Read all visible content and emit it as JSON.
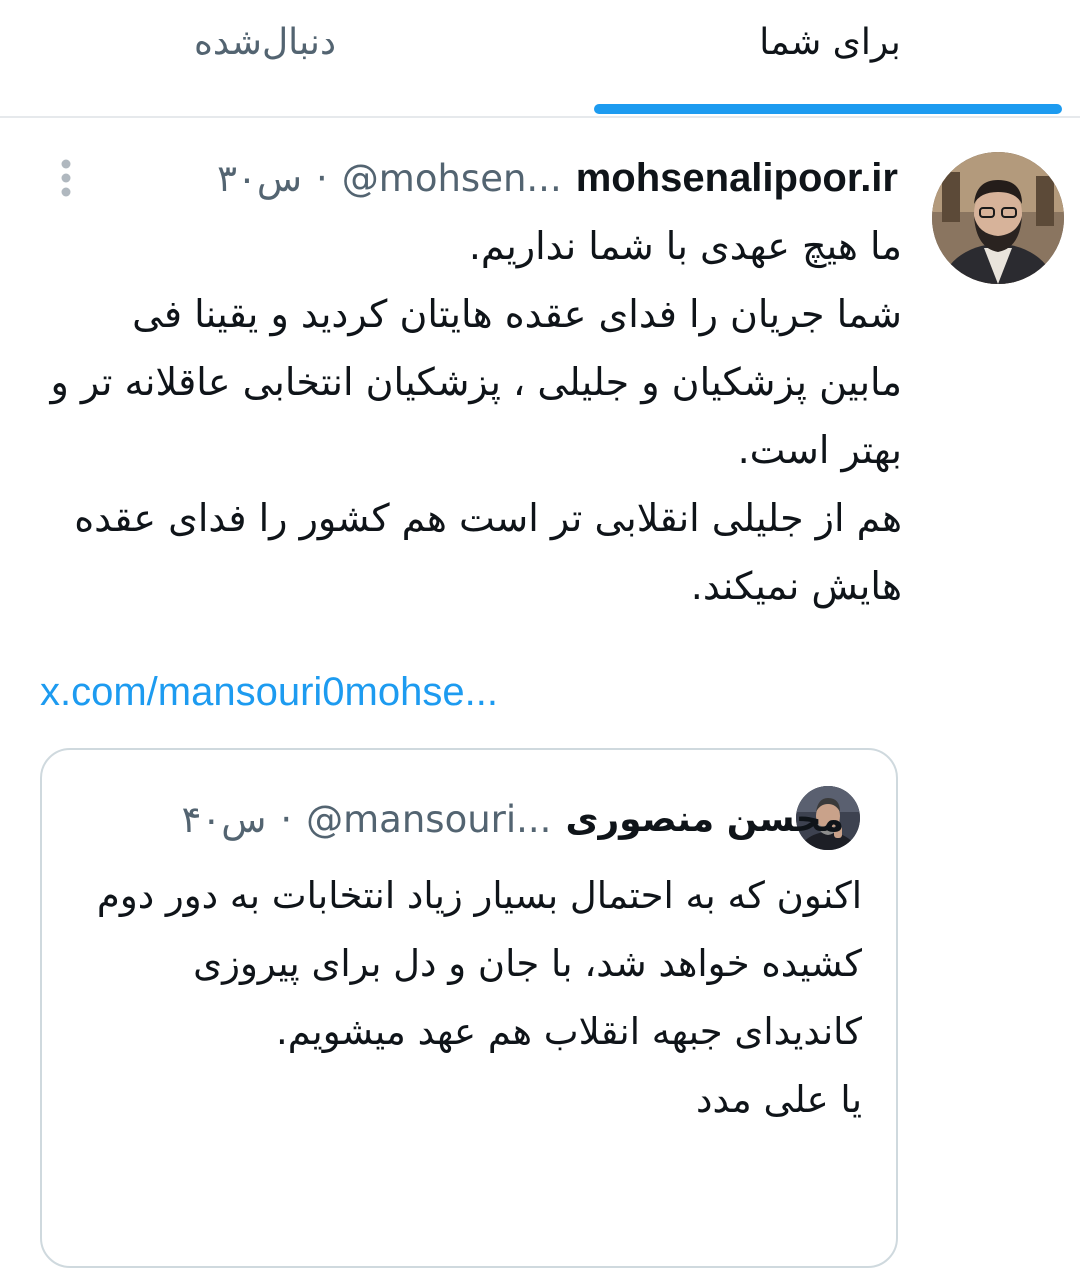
{
  "tabs": [
    {
      "label": "برای شما",
      "active": true
    },
    {
      "label": "دنبال‌شده",
      "active": false
    }
  ],
  "accent_color": "#1d9bf0",
  "tweet": {
    "author_name": "mohsenalipoor.ir",
    "handle": "@mohsen...",
    "separator": "·",
    "time": "۳۰س",
    "more_icon": "more-vertical-icon",
    "paragraphs": [
      "ما هیچ عهدی با شما نداریم.",
      "شما جریان را فدای عقده هایتان کردید و یقینا فی مابین پزشکیان و جلیلی ، پزشکیان انتخابی عاقلانه تر و بهتر است.",
      "هم از جلیلی انقلابی تر است هم کشور را فدای عقده هایش نمیکند."
    ],
    "link": "x.com/mansouri0mohse..."
  },
  "quote": {
    "author_name": "محسن منصوری",
    "handle": "@mansouri...",
    "separator": "·",
    "time": "۴۰س",
    "paragraphs": [
      "اکنون که به احتمال بسیار زیاد انتخابات به دور دوم کشیده خواهد شد،  با جان و دل برای پیروزی کاندیدای جبهه انقلاب هم عهد میشویم.",
      "یا علی مدد"
    ]
  }
}
